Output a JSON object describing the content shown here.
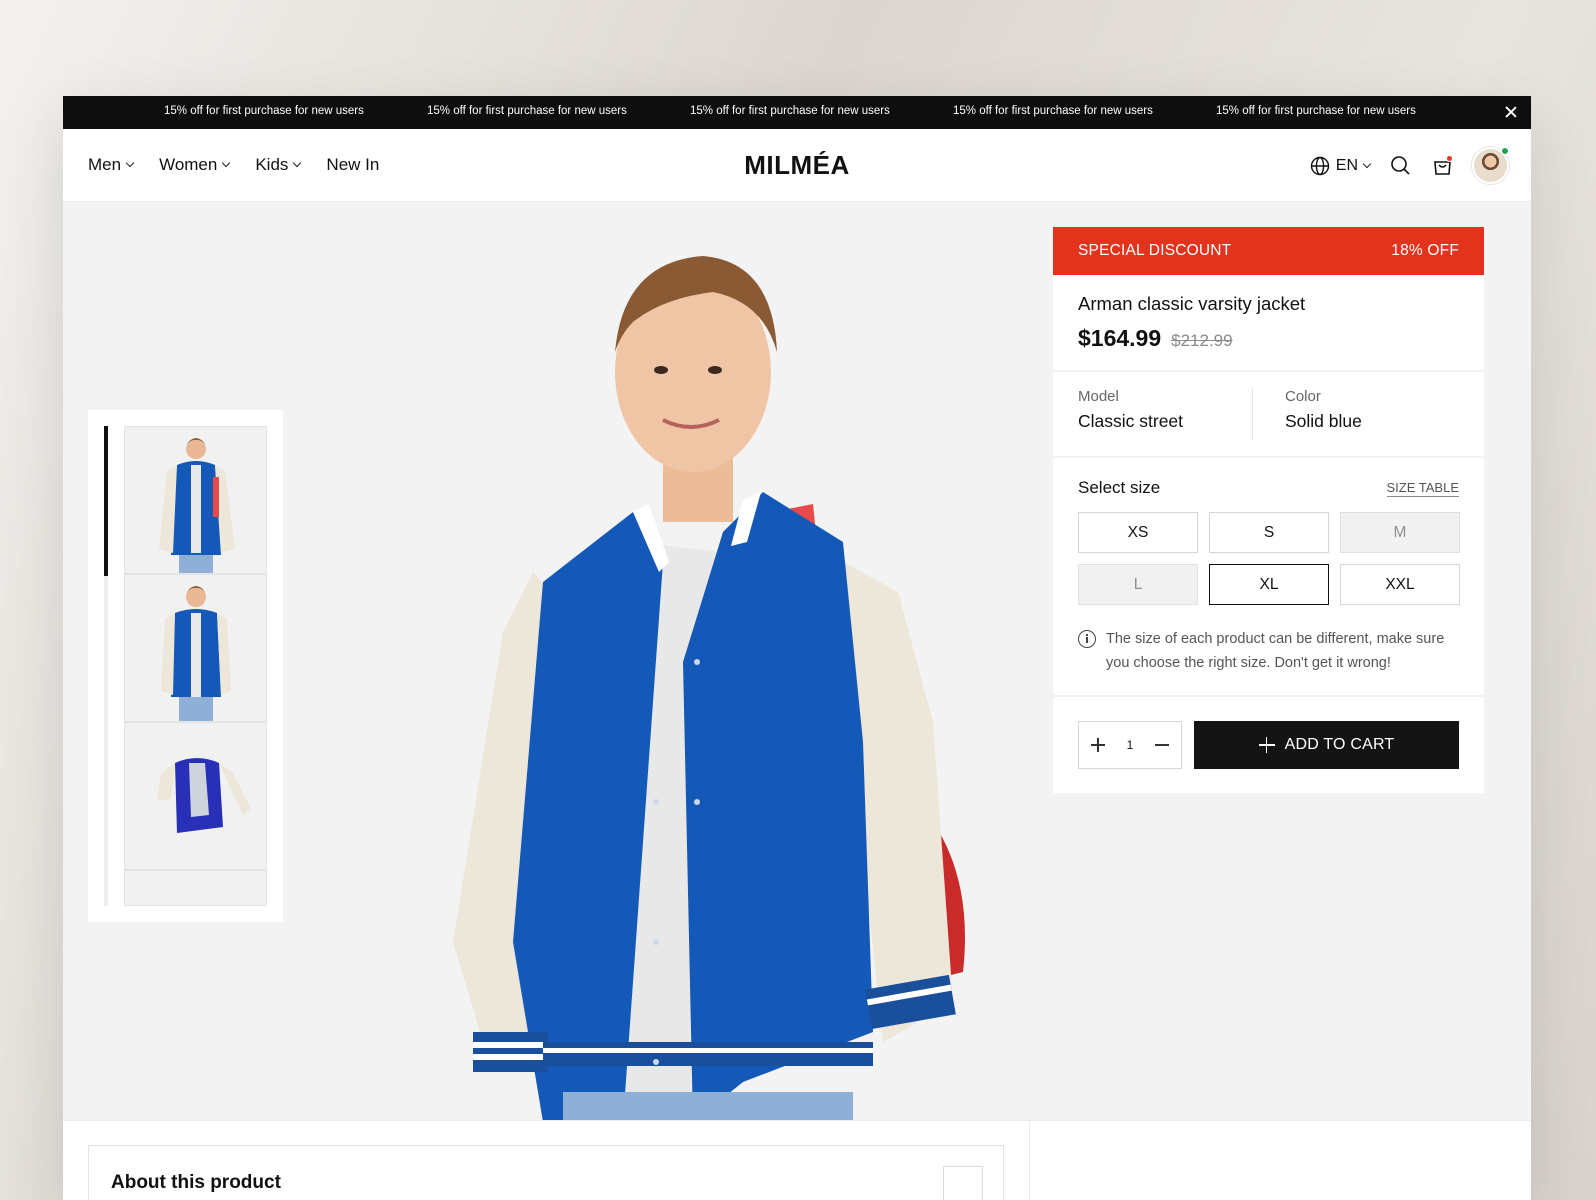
{
  "promo": {
    "items": [
      "15% off for first purchase for new users",
      "15% off for first purchase for new users",
      "15% off for first purchase for new users",
      "15% off for first purchase for new users",
      "15% off for first purchase for new users"
    ]
  },
  "header": {
    "nav": [
      "Men",
      "Women",
      "Kids",
      "New In"
    ],
    "logo": "MILMÉA",
    "language": "EN"
  },
  "product": {
    "discount_label": "SPECIAL DISCOUNT",
    "discount_value": "18% OFF",
    "title": "Arman classic varsity jacket",
    "price": "$164.99",
    "old_price": "$212.99",
    "model_label": "Model",
    "model_value": "Classic street",
    "color_label": "Color",
    "color_value": "Solid blue",
    "size_title": "Select size",
    "size_table": "SIZE TABLE",
    "sizes": [
      "XS",
      "S",
      "M",
      "L",
      "XL",
      "XXL"
    ],
    "size_note": "The size of each product can be different, make sure you choose the right size. Don't get it wrong!",
    "quantity": "1",
    "add_to_cart": "ADD TO CART"
  },
  "about": {
    "title": "About this product"
  },
  "colors": {
    "discount": "#e4331d",
    "jacket_blue": "#1459b8",
    "cart_button": "#141414"
  }
}
